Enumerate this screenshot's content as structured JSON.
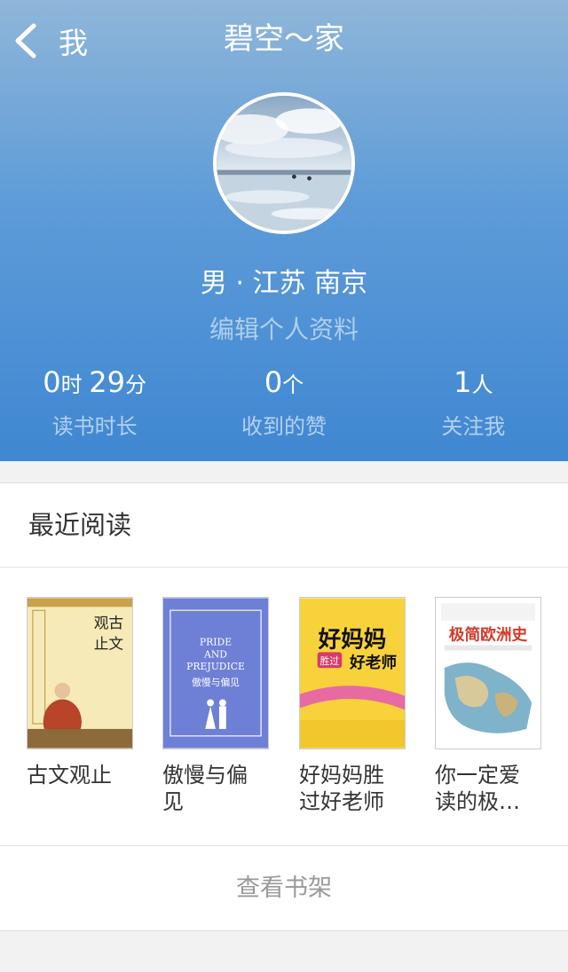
{
  "nav": {
    "back_label": "我",
    "title": "碧空～家"
  },
  "profile": {
    "location": "男 · 江苏 南京",
    "edit_label": "编辑个人资料"
  },
  "stats": [
    {
      "v1": "0",
      "u1": "时 ",
      "v2": "29",
      "u2": "分",
      "label": "读书时长"
    },
    {
      "v1": "0",
      "u1": "个",
      "v2": "",
      "u2": "",
      "label": "收到的赞"
    },
    {
      "v1": "1",
      "u1": "人",
      "v2": "",
      "u2": "",
      "label": "关注我"
    }
  ],
  "recent": {
    "title": "最近阅读",
    "books": [
      {
        "title": "古文观止",
        "cover": {
          "line1": "观古",
          "line2": "止文"
        }
      },
      {
        "title": "傲慢与偏见",
        "cover": {
          "line1": "PRIDE",
          "line2": "AND",
          "line3": "PREJUDICE",
          "line4": "傲慢与偏见"
        }
      },
      {
        "title": "好妈妈胜过好老师",
        "cover": {
          "line1": "好妈妈",
          "line2": "胜过",
          "line3": "好老师"
        }
      },
      {
        "title": "你一定爱读的极…",
        "cover": {
          "line1": "极简欧洲史"
        }
      }
    ],
    "shelf_label": "查看书架"
  },
  "colors": {
    "header_top": "#8fb6d9",
    "header_bottom": "#3f87d2",
    "background": "#f2f2f2"
  }
}
